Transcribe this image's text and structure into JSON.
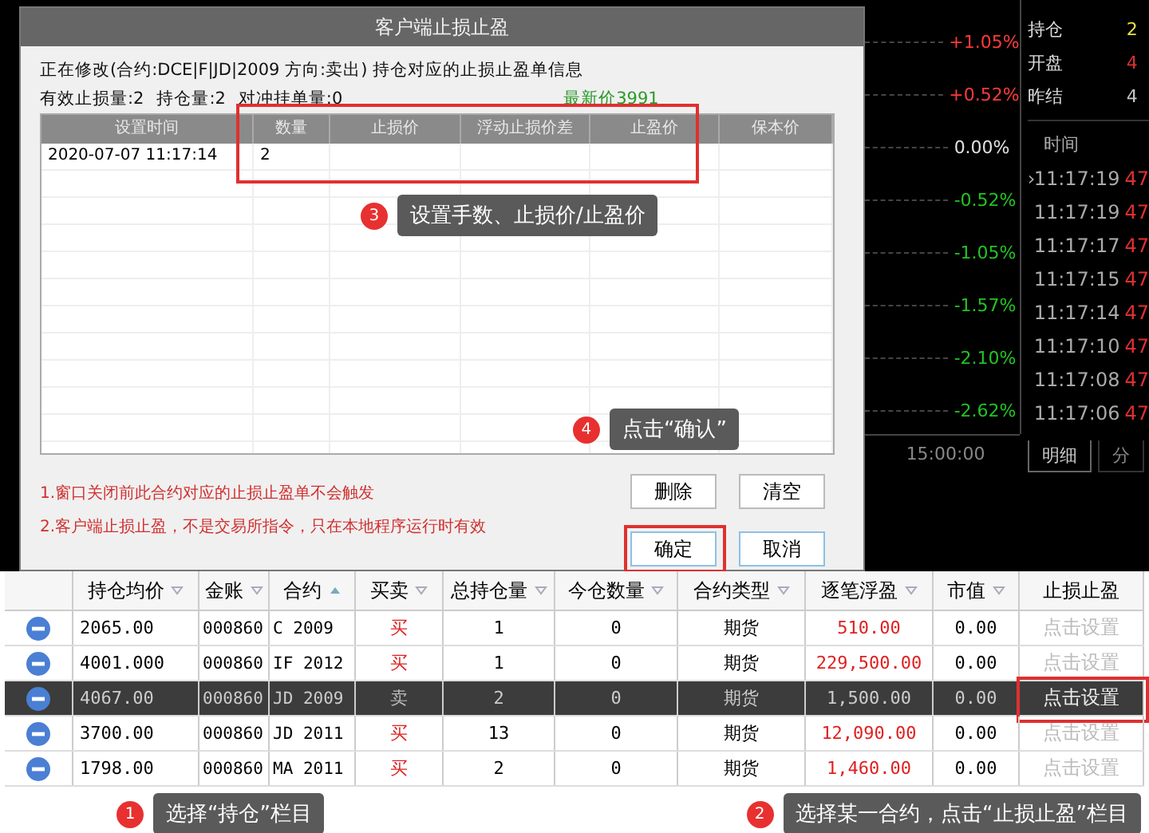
{
  "dialog": {
    "title": "客户端止损止盈",
    "info_line": "正在修改(合约:DCE|F|JD|2009  方向:卖出)  持仓对应的止损止盈单信息",
    "stats": [
      "有效止损量:2",
      "持仓量:2",
      "对冲挂单量:0"
    ],
    "latest_price": "最新价3991",
    "table": {
      "columns": [
        "设置时间",
        "数量",
        "止损价",
        "浮动止损价差",
        "止盈价",
        "保本价"
      ],
      "rows": [
        {
          "set_time": "2020-07-07 11:17:14",
          "quantity": "2"
        }
      ]
    },
    "table_callout": {
      "number": "3",
      "text": "设置手数、止损价/止盈价"
    },
    "confirm_callout": {
      "number": "4",
      "text": "点击“确认”"
    },
    "notes": [
      "1.窗口关闭前此合约对应的止损止盈单不会触发",
      "2.客户端止损止盈，不是交易所指令，只在本地程序运行时有效"
    ],
    "buttons": [
      {
        "label": "删除",
        "highlighted": false
      },
      {
        "label": "清空",
        "highlighted": false
      },
      {
        "label": "确定",
        "highlighted": true
      },
      {
        "label": "取消",
        "highlighted": false
      }
    ]
  },
  "chart_panel": {
    "percent_labels": [
      {
        "text": "+1.05%",
        "color": "#ff3b3b"
      },
      {
        "text": "+0.52%",
        "color": "#ff3b3b"
      },
      {
        "text": "0.00%",
        "color": "#e0e0e0"
      },
      {
        "text": "-0.52%",
        "color": "#22c422"
      },
      {
        "text": "-1.05%",
        "color": "#22c422"
      },
      {
        "text": "-1.57%",
        "color": "#22c422"
      },
      {
        "text": "-2.10%",
        "color": "#22c422"
      },
      {
        "text": "-2.62%",
        "color": "#22c422"
      }
    ],
    "time_label": "15:00:00"
  },
  "quote_panel": {
    "fields": [
      {
        "label": "持仓",
        "value": "2",
        "color": "#e8e04a"
      },
      {
        "label": "开盘",
        "value": "4",
        "color": "#e03030"
      },
      {
        "label": "昨结",
        "value": "4",
        "color": "#c8c8c8"
      }
    ],
    "trades_header": "时间",
    "trades": [
      {
        "marker": "›",
        "time": "11:17:19",
        "price": "47"
      },
      {
        "time": "11:17:19",
        "price": "47"
      },
      {
        "time": "11:17:17",
        "price": "47"
      },
      {
        "time": "11:17:15",
        "price": "47"
      },
      {
        "time": "11:17:14",
        "price": "47"
      },
      {
        "time": "11:17:10",
        "price": "47"
      },
      {
        "time": "11:17:08",
        "price": "47"
      },
      {
        "time": "11:17:06",
        "price": "47"
      }
    ],
    "tabs": [
      {
        "label": "明细",
        "selected": true
      },
      {
        "label": "分",
        "selected": false
      }
    ]
  },
  "positions_table": {
    "columns": [
      {
        "label": "持仓均价",
        "kind": "filter"
      },
      {
        "label": "金账",
        "kind": "filter"
      },
      {
        "label": "合约",
        "kind": "sort_asc"
      },
      {
        "label": "买卖",
        "kind": "filter"
      },
      {
        "label": "总持仓量",
        "kind": "filter"
      },
      {
        "label": "今仓数量",
        "kind": "filter"
      },
      {
        "label": "合约类型",
        "kind": "filter"
      },
      {
        "label": "逐笔浮盈",
        "kind": "filter"
      },
      {
        "label": "市值",
        "kind": "filter"
      },
      {
        "label": "止损止盈",
        "kind": "plain"
      }
    ],
    "rows": [
      {
        "avg_price": "2065.00",
        "account": "000860",
        "contract": "C 2009",
        "side": {
          "text": "买",
          "color": "#e02020"
        },
        "total": "1",
        "today": "0",
        "type": "期货",
        "pnl": "510.00",
        "market_value": "0.00",
        "stop_setting": "点击设置",
        "selected": false
      },
      {
        "avg_price": "4001.000",
        "account": "000860",
        "contract": "IF 2012",
        "side": {
          "text": "买",
          "color": "#e02020"
        },
        "total": "1",
        "today": "0",
        "type": "期货",
        "pnl": "229,500.00",
        "market_value": "0.00",
        "stop_setting": "点击设置",
        "selected": false
      },
      {
        "avg_price": "4067.00",
        "account": "000860",
        "contract": "JD 2009",
        "side": {
          "text": "卖",
          "color": "#bbbbbb"
        },
        "total": "2",
        "today": "0",
        "type": "期货",
        "pnl": "1,500.00",
        "market_value": "0.00",
        "stop_setting": "点击设置",
        "selected": true
      },
      {
        "avg_price": "3700.00",
        "account": "000860",
        "contract": "JD 2011",
        "side": {
          "text": "买",
          "color": "#e02020"
        },
        "total": "13",
        "today": "0",
        "type": "期货",
        "pnl": "12,090.00",
        "market_value": "0.00",
        "stop_setting": "点击设置",
        "selected": false
      },
      {
        "avg_price": "1798.00",
        "account": "000860",
        "contract": "MA 2011",
        "side": {
          "text": "买",
          "color": "#e02020"
        },
        "total": "2",
        "today": "0",
        "type": "期货",
        "pnl": "1,460.00",
        "market_value": "0.00",
        "stop_setting": "点击设置",
        "selected": false
      }
    ],
    "callouts": [
      {
        "number": "1",
        "text": "选择“持仓”栏目"
      },
      {
        "number": "2",
        "text": "选择某一合约，点击“止损止盈”栏目"
      }
    ]
  }
}
